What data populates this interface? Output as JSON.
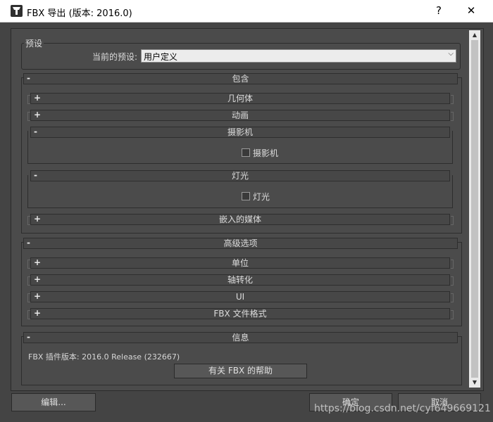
{
  "window": {
    "title": "FBX 导出 (版本: 2016.0)",
    "help_label": "?",
    "close_label": "✕"
  },
  "preset": {
    "group_label": "预设",
    "current_label": "当前的预设:",
    "current_value": "用户定义"
  },
  "include": {
    "label": "包含",
    "sign": "-",
    "geometry": {
      "label": "几何体",
      "sign": "+"
    },
    "animation": {
      "label": "动画",
      "sign": "+"
    },
    "camera": {
      "label": "摄影机",
      "sign": "-",
      "checkbox": "摄影机"
    },
    "light": {
      "label": "灯光",
      "sign": "-",
      "checkbox": "灯光"
    },
    "media": {
      "label": "嵌入的媒体",
      "sign": "+"
    }
  },
  "advanced": {
    "label": "高级选项",
    "sign": "-",
    "units": {
      "label": "单位",
      "sign": "+"
    },
    "axis": {
      "label": "轴转化",
      "sign": "+"
    },
    "ui": {
      "label": "UI",
      "sign": "+"
    },
    "fbx_format": {
      "label": "FBX 文件格式",
      "sign": "+"
    }
  },
  "info": {
    "label": "信息",
    "sign": "-",
    "version_text": "FBX 插件版本: 2016.0 Release (232667)",
    "help_button": "有关 FBX 的帮助"
  },
  "footer": {
    "edit_button": "编辑...",
    "ok_button": "确定",
    "cancel_button": "取消"
  },
  "watermark": "https://blog.csdn.net/cyf649669121"
}
